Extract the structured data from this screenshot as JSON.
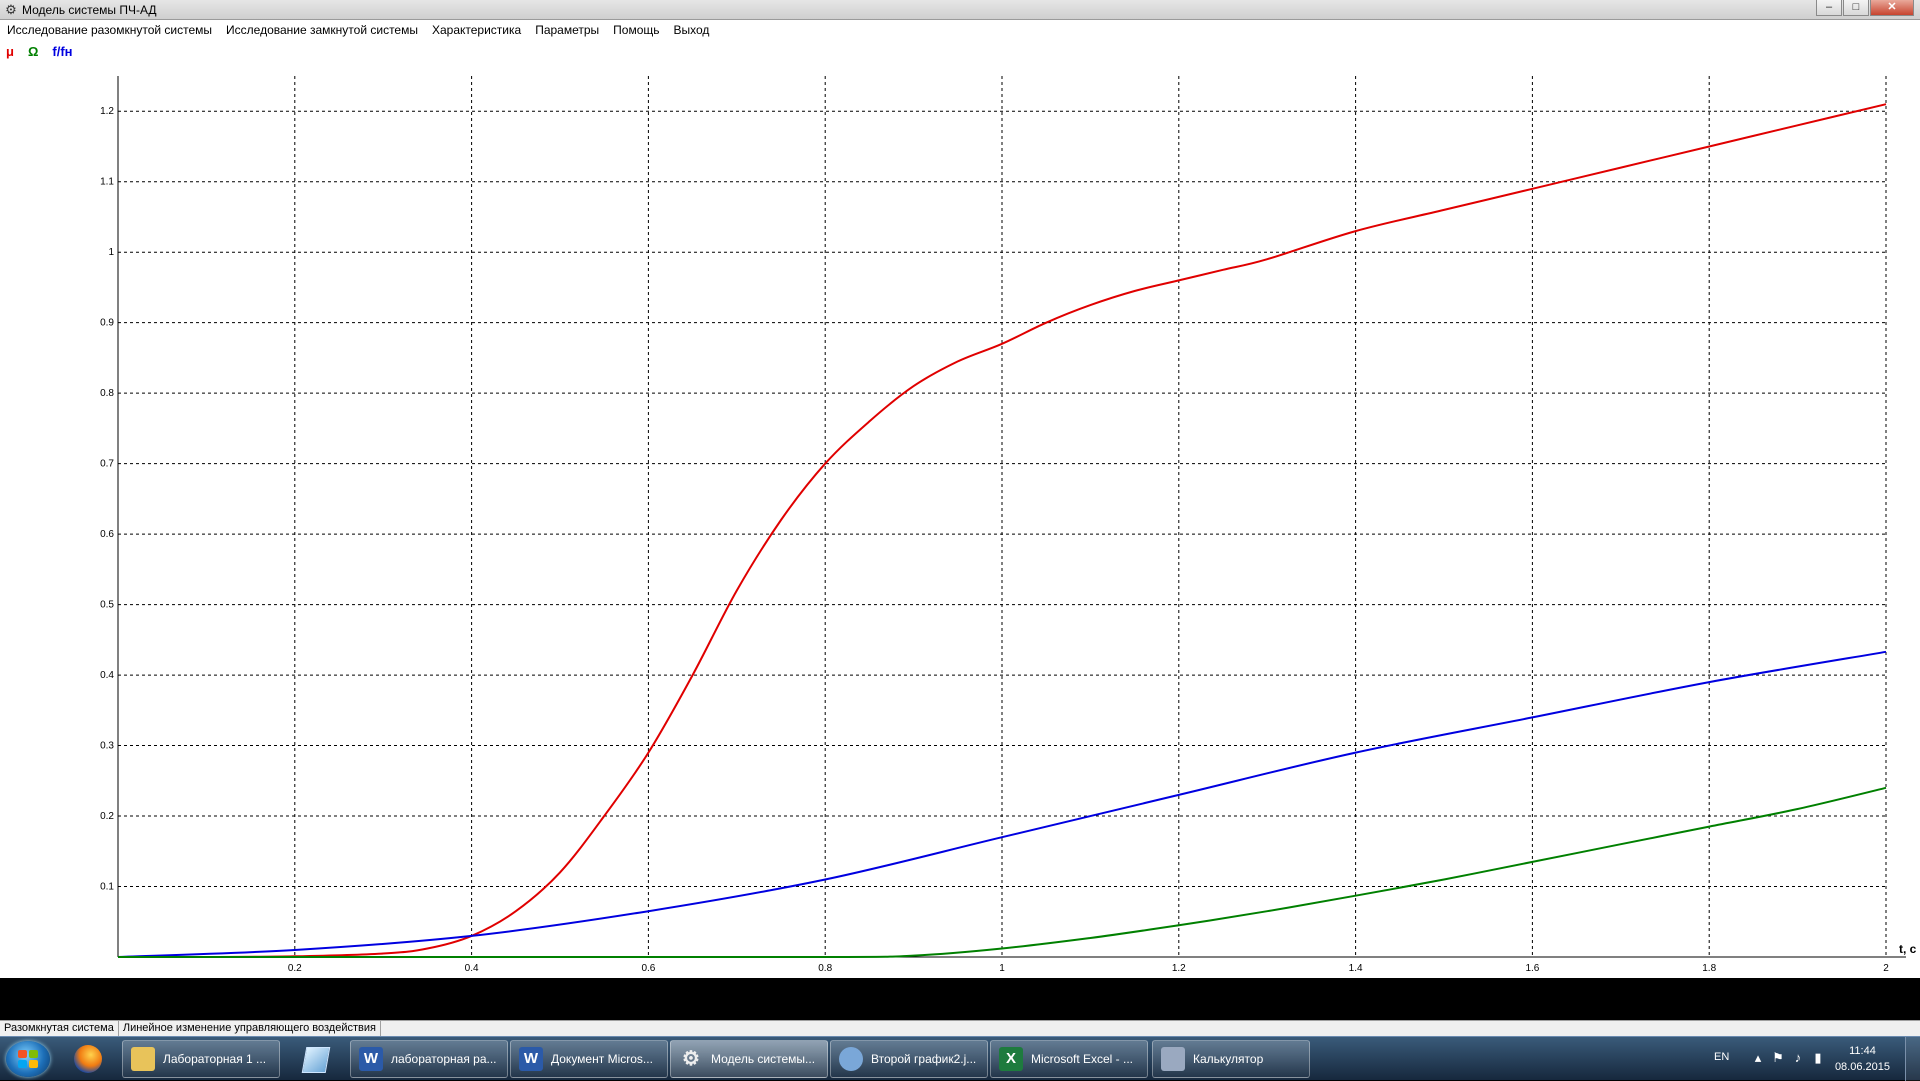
{
  "window": {
    "title": "Модель системы ПЧ-АД"
  },
  "menu": [
    "Исследование разомкнутой системы",
    "Исследование замкнутой системы",
    "Характеристика",
    "Параметры",
    "Помощь",
    "Выход"
  ],
  "legend": [
    {
      "label": "μ",
      "color": "#e00000"
    },
    {
      "label": "Ω",
      "color": "#008000"
    },
    {
      "label": "f/fн",
      "color": "#0000e0"
    }
  ],
  "chart_data": {
    "type": "line",
    "xlabel": "t, c",
    "xlim": [
      0,
      2
    ],
    "ylim": [
      0,
      1.25
    ],
    "x_ticks": [
      "0.2",
      "0.4",
      "0.6",
      "0.8",
      "1",
      "1.2",
      "1.4",
      "1.6",
      "1.8",
      "2"
    ],
    "y_ticks": [
      "0.1",
      "0.2",
      "0.3",
      "0.4",
      "0.5",
      "0.6",
      "0.7",
      "0.8",
      "0.9",
      "1",
      "1.1",
      "1.2"
    ],
    "grid": true,
    "series": [
      {
        "name": "μ",
        "color": "#e00000",
        "x": [
          0,
          0.1,
          0.2,
          0.3,
          0.35,
          0.4,
          0.45,
          0.5,
          0.55,
          0.6,
          0.65,
          0.7,
          0.75,
          0.8,
          0.85,
          0.9,
          0.95,
          1.0,
          1.05,
          1.1,
          1.15,
          1.2,
          1.25,
          1.3,
          1.4,
          1.5,
          1.6,
          1.7,
          1.8,
          1.9,
          2.0
        ],
        "y": [
          0,
          0,
          0.001,
          0.005,
          0.012,
          0.03,
          0.065,
          0.12,
          0.2,
          0.29,
          0.4,
          0.52,
          0.62,
          0.7,
          0.76,
          0.81,
          0.845,
          0.87,
          0.9,
          0.925,
          0.945,
          0.96,
          0.975,
          0.99,
          1.03,
          1.06,
          1.09,
          1.12,
          1.15,
          1.18,
          1.21
        ]
      },
      {
        "name": "f/fн",
        "color": "#0000e0",
        "x": [
          0,
          0.2,
          0.4,
          0.6,
          0.8,
          1.0,
          1.2,
          1.4,
          1.6,
          1.8,
          2.0
        ],
        "y": [
          0,
          0.01,
          0.03,
          0.065,
          0.11,
          0.17,
          0.23,
          0.29,
          0.34,
          0.39,
          0.433
        ]
      },
      {
        "name": "Ω",
        "color": "#008000",
        "x": [
          0,
          0.4,
          0.8,
          0.9,
          1.0,
          1.1,
          1.2,
          1.3,
          1.4,
          1.5,
          1.6,
          1.7,
          1.8,
          1.9,
          2.0
        ],
        "y": [
          0,
          0,
          0,
          0.002,
          0.012,
          0.027,
          0.045,
          0.065,
          0.087,
          0.11,
          0.135,
          0.16,
          0.185,
          0.21,
          0.24
        ]
      }
    ]
  },
  "status": {
    "mode": "Разомкнутая система",
    "message": "Линейное изменение управляющего воздействия"
  },
  "taskbar": {
    "tasks": [
      {
        "label": "Лабораторная 1 ...",
        "icon": "folder-icon",
        "color": "#e8c35a"
      },
      {
        "label": "лабораторная ра...",
        "icon": "word-icon",
        "color": "#2b5aa8"
      },
      {
        "label": "Документ Micros...",
        "icon": "word-icon",
        "color": "#2b5aa8"
      },
      {
        "label": "Модель системы...",
        "icon": "gear-icon",
        "color": "#d0d0d0"
      },
      {
        "label": "Второй график2.j...",
        "icon": "paint-icon",
        "color": "#7aa7d8"
      },
      {
        "label": "Microsoft Excel - ...",
        "icon": "excel-icon",
        "color": "#1e7b3e"
      },
      {
        "label": "Калькулятор",
        "icon": "calculator-icon",
        "color": "#9aa9c0"
      }
    ],
    "tray": {
      "lang": "EN",
      "time": "11:44",
      "date": "08.06.2015"
    }
  }
}
